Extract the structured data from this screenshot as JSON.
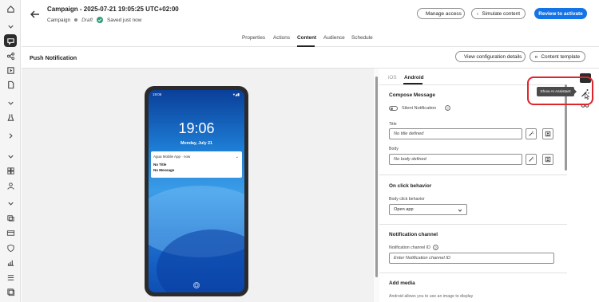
{
  "header": {
    "title": "Campaign - 2025-07-21 19:05:25 UTC+02:00",
    "breadcrumb": "Campaign",
    "status": "Draft",
    "saved": "Saved just now",
    "manage_access": "Manage access",
    "simulate_content": "Simulate content",
    "review_button": "Review to activate"
  },
  "tabs": [
    "Properties",
    "Actions",
    "Content",
    "Audience",
    "Schedule"
  ],
  "selected_tab": "Content",
  "section": {
    "title": "Push Notification",
    "view_config": "View configuration details",
    "content_template": "Content template"
  },
  "phone": {
    "status_time": "19:06",
    "clock": "19:06",
    "date": "Monday, July 21",
    "notification_app": "Agua Mobile App · now",
    "notification_title": "No Title",
    "notification_message": "No Message"
  },
  "panel": {
    "tabs": [
      "iOS",
      "Android"
    ],
    "selected_tab": "Android",
    "compose_heading": "Compose Message",
    "silent_label": "Silent Notification",
    "title_label": "Title",
    "title_placeholder": "No title defined",
    "body_label": "Body",
    "body_placeholder": "No body defined",
    "onclick_heading": "On click behavior",
    "body_click_label": "Body click behavior",
    "body_click_value": "Open app",
    "channel_heading": "Notification channel",
    "channel_id_label": "Notification channel ID",
    "channel_id_placeholder": "Enter Notification channel ID",
    "add_media_heading": "Add media",
    "add_media_desc": "Android allows you to use an image to display"
  },
  "tooltip": "Show AI Assistant",
  "colors": {
    "primary": "#1473e6",
    "saved_check": "#2d9d78",
    "highlight": "#e0252a"
  }
}
